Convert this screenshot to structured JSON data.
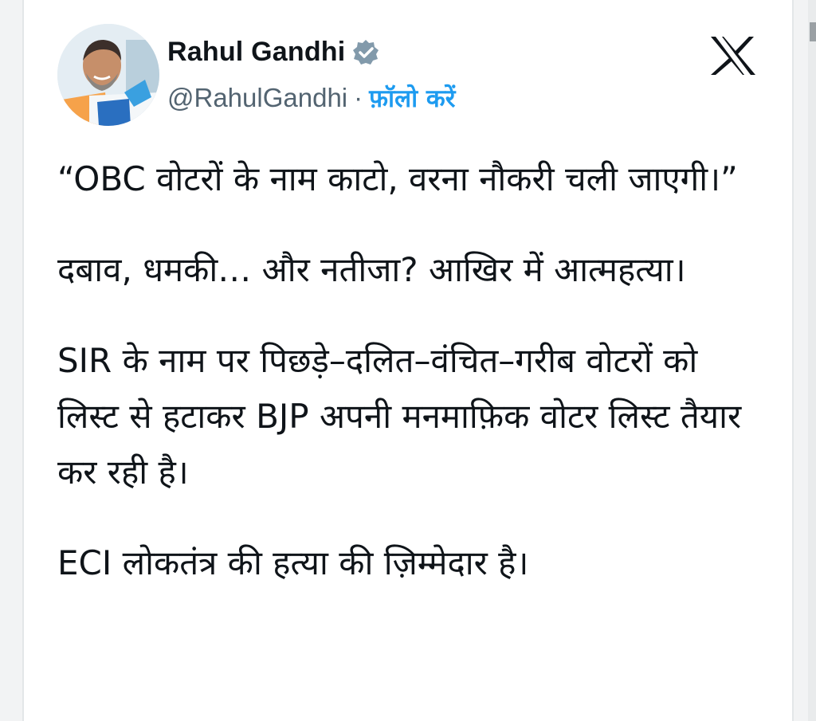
{
  "author": {
    "name": "Rahul Gandhi",
    "handle": "@RahulGandhi",
    "separator": "·",
    "follow_label": "फ़ॉलो करें",
    "verified_icon": "verified-badge-icon"
  },
  "platform_icon": "x-logo-icon",
  "colors": {
    "follow_blue": "#1d9bf0",
    "handle_gray": "#536471",
    "text": "#0f1419"
  },
  "tweet": {
    "paragraphs": [
      "“OBC वोटरों के नाम काटो, वरना नौकरी चली जाएगी।”",
      "दबाव, धमकी… और नतीजा? आखिर में आत्महत्या।",
      "SIR के नाम पर पिछड़े–दलित–वंचित–गरीब वोटरों को लिस्ट से हटाकर BJP अपनी मनमाफ़िक वोटर लिस्ट तैयार कर रही है।",
      "ECI लोकतंत्र की हत्या की ज़िम्मेदार है।"
    ]
  }
}
